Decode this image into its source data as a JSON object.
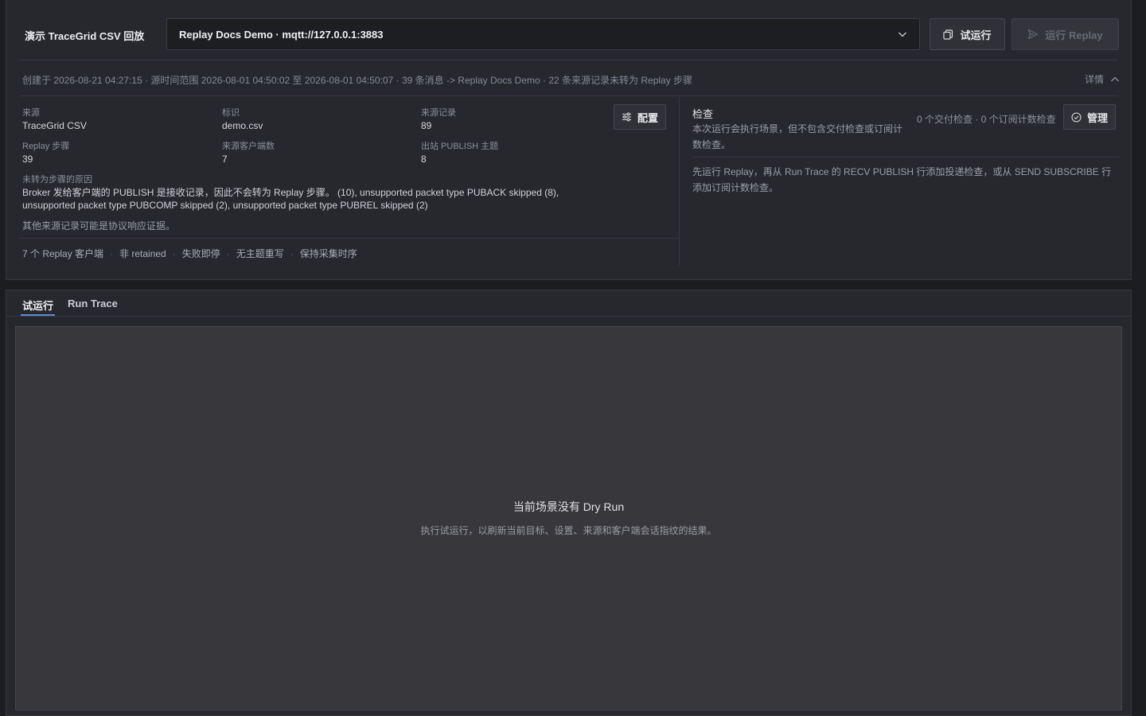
{
  "header": {
    "scenario_title": "演示 TraceGrid CSV 回放",
    "target_select": {
      "value": "Replay Docs Demo · mqtt://127.0.0.1:3883"
    },
    "dry_run_button": "试运行",
    "run_replay_button": "运行 Replay"
  },
  "meta": {
    "summary": "创建于 2026-08-21 04:27:15 · 源时间范围 2026-08-01 04:50:02 至 2026-08-01 04:50:07 · 39 条消息 -> Replay Docs Demo · 22 条来源记录未转为 Replay 步骤",
    "details_toggle": "详情"
  },
  "source_info": {
    "source_label": "来源",
    "source_value": "TraceGrid CSV",
    "id_label": "标识",
    "id_value": "demo.csv",
    "records_label": "来源记录",
    "records_value": "89",
    "steps_label": "Replay 步骤",
    "steps_value": "39",
    "clients_label": "来源客户端数",
    "clients_value": "7",
    "topics_label": "出站 PUBLISH 主题",
    "topics_value": "8",
    "config_button": "配置",
    "reason_label": "未转为步骤的原因",
    "reason_text": "Broker 发给客户端的 PUBLISH 是接收记录，因此不会转为 Replay 步骤。 (10), unsupported packet type PUBACK skipped (8), unsupported packet type PUBCOMP skipped (2), unsupported packet type PUBREL skipped (2)",
    "reason_note": "其他来源记录可能是协议响应证据。",
    "chips": [
      "7 个 Replay 客户端",
      "非 retained",
      "失败即停",
      "无主题重写",
      "保持采集时序"
    ]
  },
  "checks": {
    "title": "检查",
    "description": "本次运行会执行场景，但不包含交付检查或订阅计数检查。",
    "counts": "0 个交付检查 · 0 个订阅计数检查",
    "manage_button": "管理",
    "hint": "先运行 Replay，再从 Run Trace 的 RECV PUBLISH 行添加投递检查，或从 SEND SUBSCRIBE 行添加订阅计数检查。"
  },
  "tabs": [
    {
      "label": "试运行",
      "active": true
    },
    {
      "label": "Run Trace",
      "active": false
    }
  ],
  "empty_state": {
    "title": "当前场景没有 Dry Run",
    "description": "执行试运行，以刷新当前目标、设置、来源和客户端会话指纹的结果。"
  },
  "colors": {
    "accent": "#5a8ed6",
    "background": "#1c1d21",
    "panel": "#26282e"
  }
}
